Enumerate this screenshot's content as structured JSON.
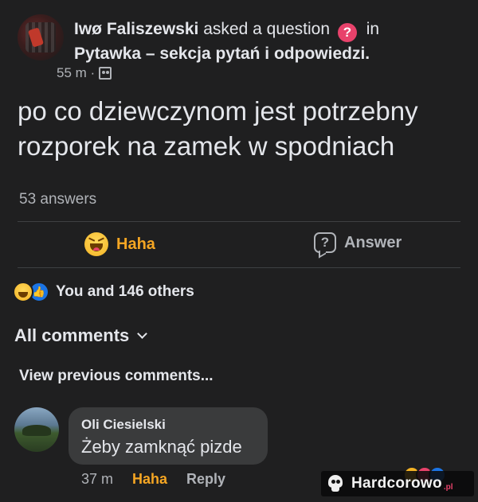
{
  "post": {
    "author": "Iwø Faliszewski",
    "action_text": "asked a question",
    "question_badge": "?",
    "in_text": "in",
    "group": "Pytawka – sekcja pytań i odpowiedzi.",
    "time": "55 m ·",
    "question": "po co dziewczynom jest potrzebny rozporek na zamek w spodniach",
    "answers_count": "53 answers"
  },
  "actions": {
    "haha_label": "Haha",
    "answer_label": "Answer",
    "answer_icon_glyph": "?"
  },
  "reactions": {
    "like_glyph": "👍",
    "summary": "You and 146 others"
  },
  "comments_section": {
    "filter_label": "All comments",
    "view_previous": "View previous comments..."
  },
  "comment": {
    "author": "Oli Ciesielski",
    "text": "Żeby zamknąć pizde",
    "time": "37 m",
    "haha_label": "Haha",
    "reply_label": "Reply"
  },
  "watermark": {
    "text": "Hardcorowo",
    "suffix": ".pl"
  },
  "colors": {
    "background": "#1f1f20",
    "haha_accent": "#f5a623",
    "badge": "#e8426b",
    "like_blue": "#1b74e4",
    "bubble": "#3a3b3c"
  }
}
